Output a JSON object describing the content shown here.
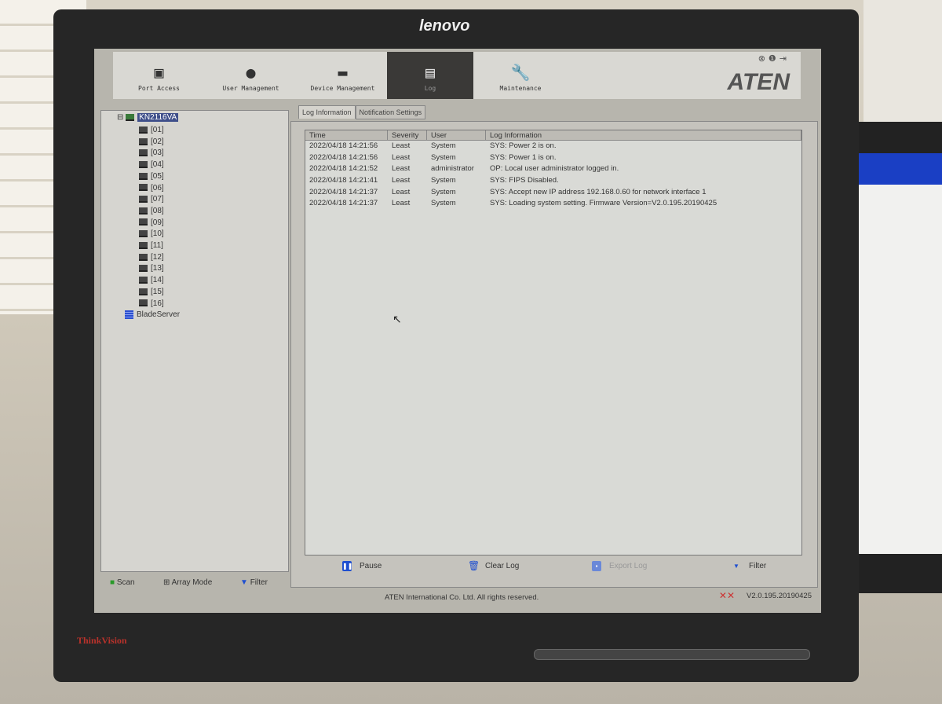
{
  "monitor": {
    "brand": "lenovo",
    "model_label": "ThinkVision"
  },
  "nav": {
    "items": [
      {
        "label": "Port Access",
        "icon": "monitor-icon"
      },
      {
        "label": "User Management",
        "icon": "user-icon"
      },
      {
        "label": "Device Management",
        "icon": "drive-icon"
      },
      {
        "label": "Log",
        "icon": "document-icon",
        "active": true
      },
      {
        "label": "Maintenance",
        "icon": "wrench-icon"
      }
    ],
    "logo": "ATEN"
  },
  "tree": {
    "root": "KN2116VA",
    "ports": [
      "[01]",
      "[02]",
      "[03]",
      "[04]",
      "[05]",
      "[06]",
      "[07]",
      "[08]",
      "[09]",
      "[10]",
      "[11]",
      "[12]",
      "[13]",
      "[14]",
      "[15]",
      "[16]"
    ],
    "blade": "BladeServer"
  },
  "left_buttons": {
    "scan": "Scan",
    "array_mode": "Array Mode",
    "filter": "Filter"
  },
  "tabs": [
    "Log Information",
    "Notification Settings"
  ],
  "log": {
    "columns": [
      "Time",
      "Severity",
      "User",
      "Log Information"
    ],
    "rows": [
      [
        "2022/04/18 14:21:56",
        "Least",
        "System",
        "SYS: Power 2 is on."
      ],
      [
        "2022/04/18 14:21:56",
        "Least",
        "System",
        "SYS: Power 1 is on."
      ],
      [
        "2022/04/18 14:21:52",
        "Least",
        "administrator",
        "OP: Local user administrator logged in."
      ],
      [
        "2022/04/18 14:21:41",
        "Least",
        "System",
        "SYS: FIPS Disabled."
      ],
      [
        "2022/04/18 14:21:37",
        "Least",
        "System",
        "SYS: Accept new IP address 192.168.0.60 for network interface 1"
      ],
      [
        "2022/04/18 14:21:37",
        "Least",
        "System",
        "SYS: Loading system setting. Firmware Version=V2.0.195.20190425"
      ]
    ]
  },
  "log_buttons": {
    "pause": "Pause",
    "clear": "Clear Log",
    "export": "Export Log",
    "filter": "Filter"
  },
  "status": {
    "copyright": "ATEN International Co. Ltd. All rights reserved.",
    "version": "V2.0.195.20190425"
  }
}
